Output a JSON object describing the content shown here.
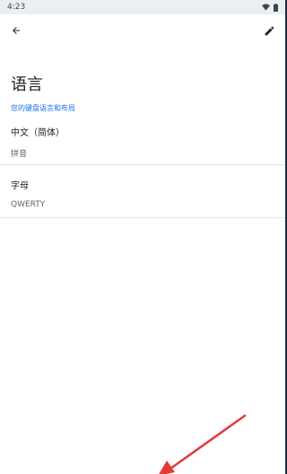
{
  "status_bar": {
    "time": "4:23"
  },
  "header": {
    "back_icon": "arrow-left-icon",
    "edit_icon": "pencil-icon"
  },
  "page": {
    "title": "语言",
    "subtitle": "您的键盘语言和布局"
  },
  "languages": [
    {
      "name": "中文（简体）",
      "layout": "拼音"
    },
    {
      "name": "字母",
      "layout": "QWERTY"
    }
  ],
  "colors": {
    "accent": "#1a73e8",
    "annotation_arrow": "#e53935"
  }
}
